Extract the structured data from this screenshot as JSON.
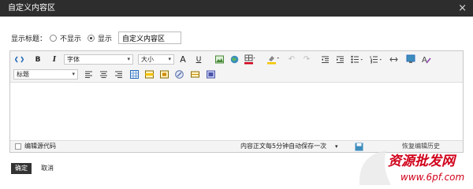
{
  "dialog": {
    "title": "自定义内容区",
    "close": "×"
  },
  "display": {
    "label": "显示标题：",
    "hide_option": "不显示",
    "show_option": "显示",
    "selected": "显示",
    "title_value": "自定义内容区"
  },
  "toolbar": {
    "source_icon": "source-code-icon",
    "bold": "B",
    "italic": "I",
    "font_label": "字体",
    "size_label": "大小",
    "underline": "U",
    "heading_label": "标题"
  },
  "colors": {
    "titlebar": "#2d2d2d",
    "accent_red": "#d0021b",
    "accent_yellow": "#f5c400",
    "blue": "#2a6ebb"
  },
  "status": {
    "edit_source": "编辑源代码",
    "autosave": "内容正文每5分钟自动保存一次",
    "history_button": "恢复编辑历史"
  },
  "actions": {
    "ok": "确定",
    "cancel": "取消"
  },
  "watermark": {
    "line1": "资源批发网",
    "line2": "www.6pf.com"
  }
}
